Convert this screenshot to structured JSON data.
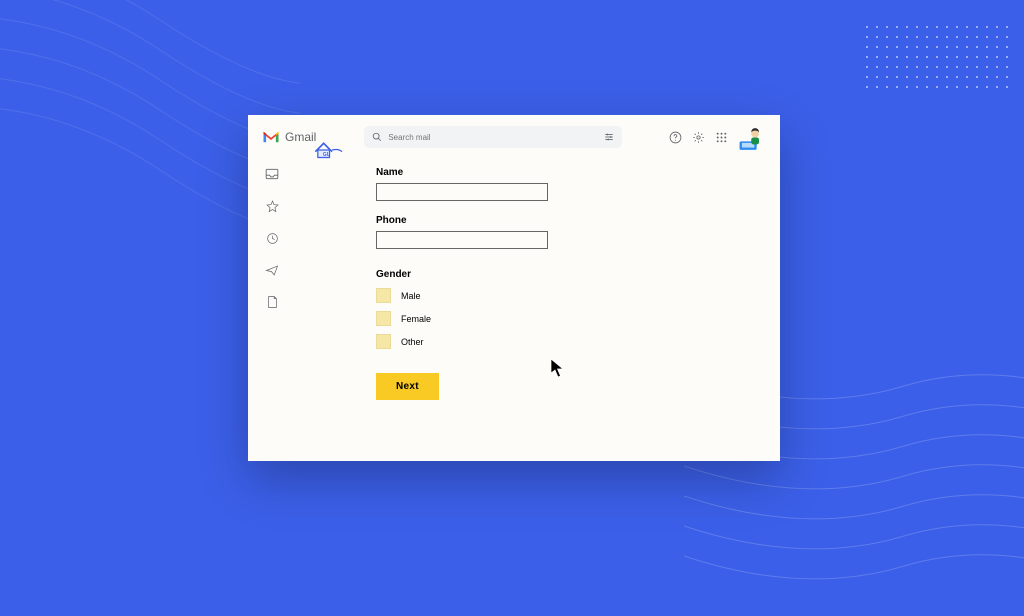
{
  "header": {
    "app_name": "Gmail",
    "search_placeholder": "Search mail"
  },
  "sidebar": {
    "items": [
      {
        "name": "inbox-icon"
      },
      {
        "name": "starred-icon"
      },
      {
        "name": "snoozed-icon"
      },
      {
        "name": "sent-icon"
      },
      {
        "name": "drafts-icon"
      }
    ]
  },
  "form": {
    "name_label": "Name",
    "name_value": "",
    "phone_label": "Phone",
    "phone_value": "",
    "gender_label": "Gender",
    "gender_options": [
      {
        "label": "Male"
      },
      {
        "label": "Female"
      },
      {
        "label": "Other"
      }
    ],
    "next_button": "Next"
  },
  "colors": {
    "background": "#3b5fe8",
    "app_bg": "#fdfcf8",
    "button": "#f9ca24",
    "radio_box": "#f6e6a8"
  }
}
